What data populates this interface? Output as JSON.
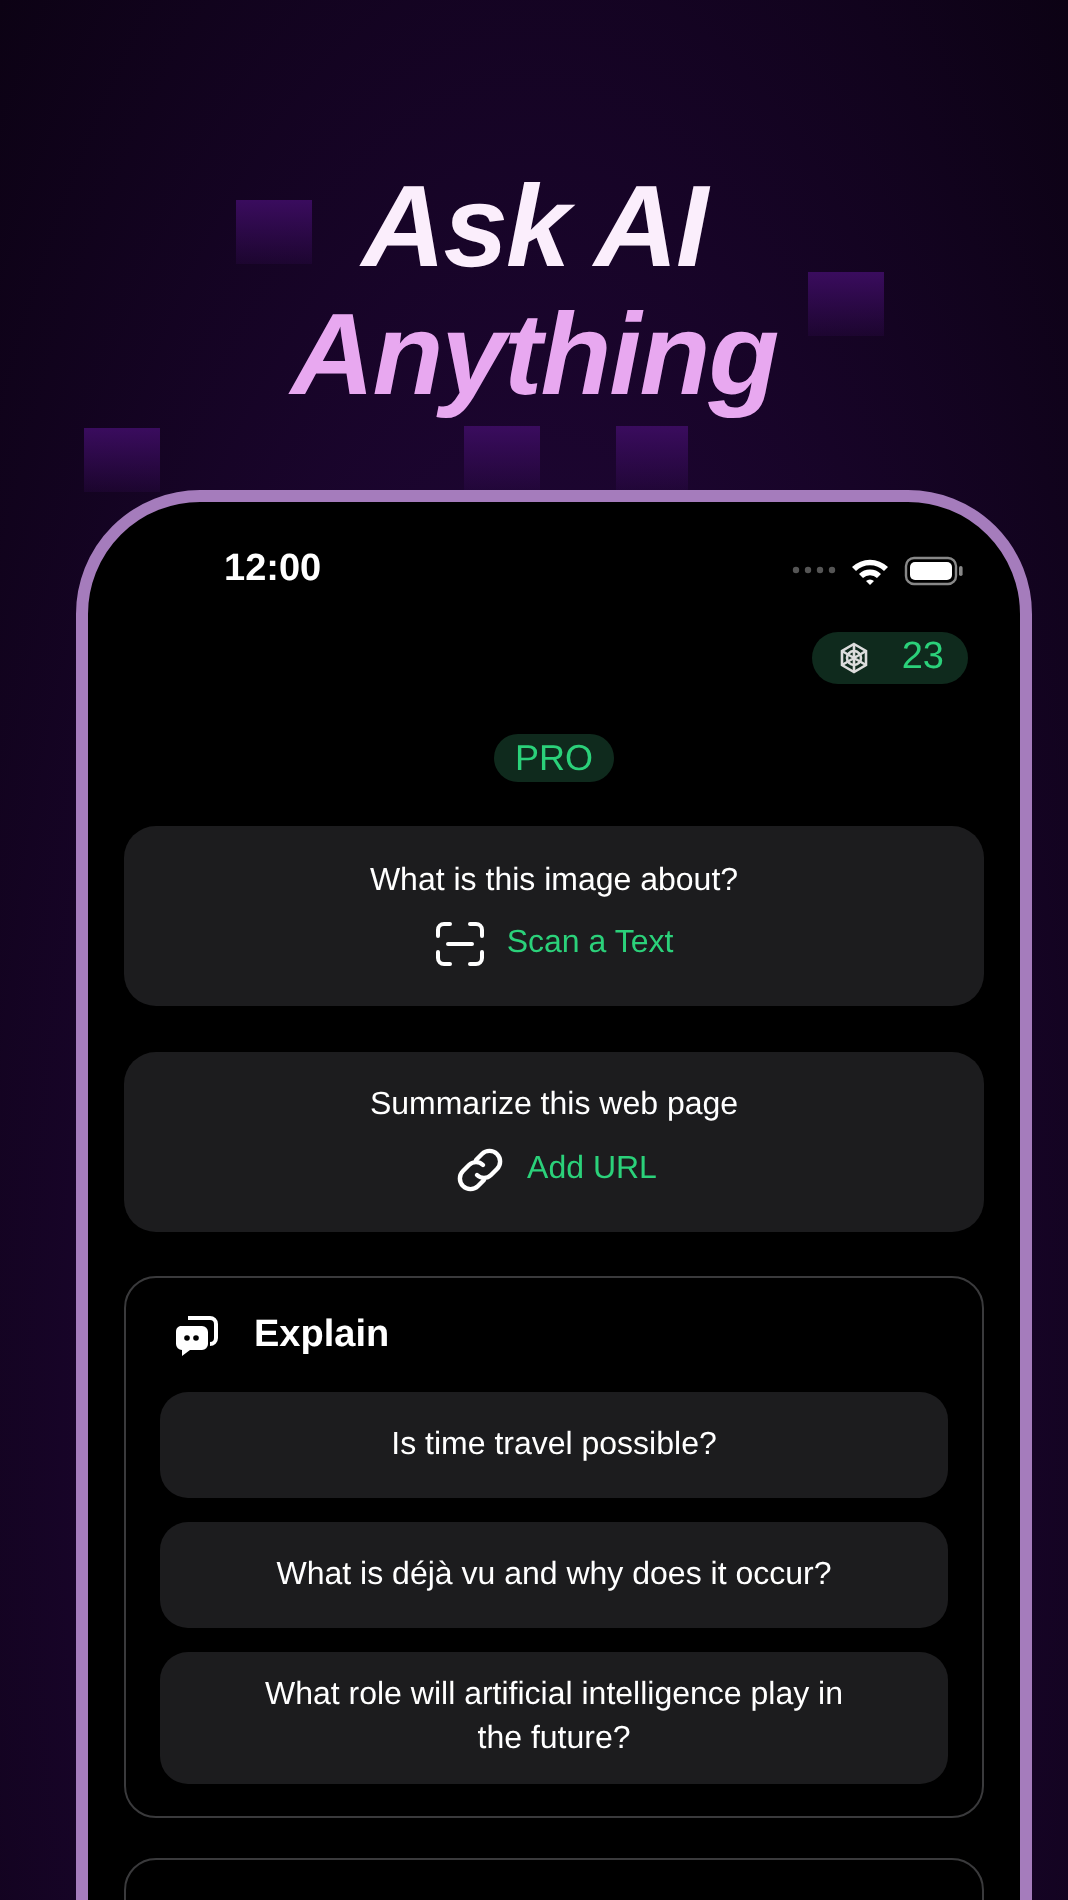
{
  "headline": [
    "Ask AI",
    "Anything"
  ],
  "status_bar": {
    "time": "12:00"
  },
  "credits": {
    "count": "23"
  },
  "plan_badge": "PRO",
  "quick_actions": [
    {
      "prompt": "What is this image about?",
      "action": "Scan a Text",
      "kind": "scan"
    },
    {
      "prompt": "Summarize this web page",
      "action": "Add URL",
      "kind": "link"
    }
  ],
  "section": {
    "title": "Explain",
    "suggestions": [
      "Is time travel possible?",
      "What is déjà vu and why does it occur?",
      "What role will artificial intelligence play in the future?"
    ]
  }
}
